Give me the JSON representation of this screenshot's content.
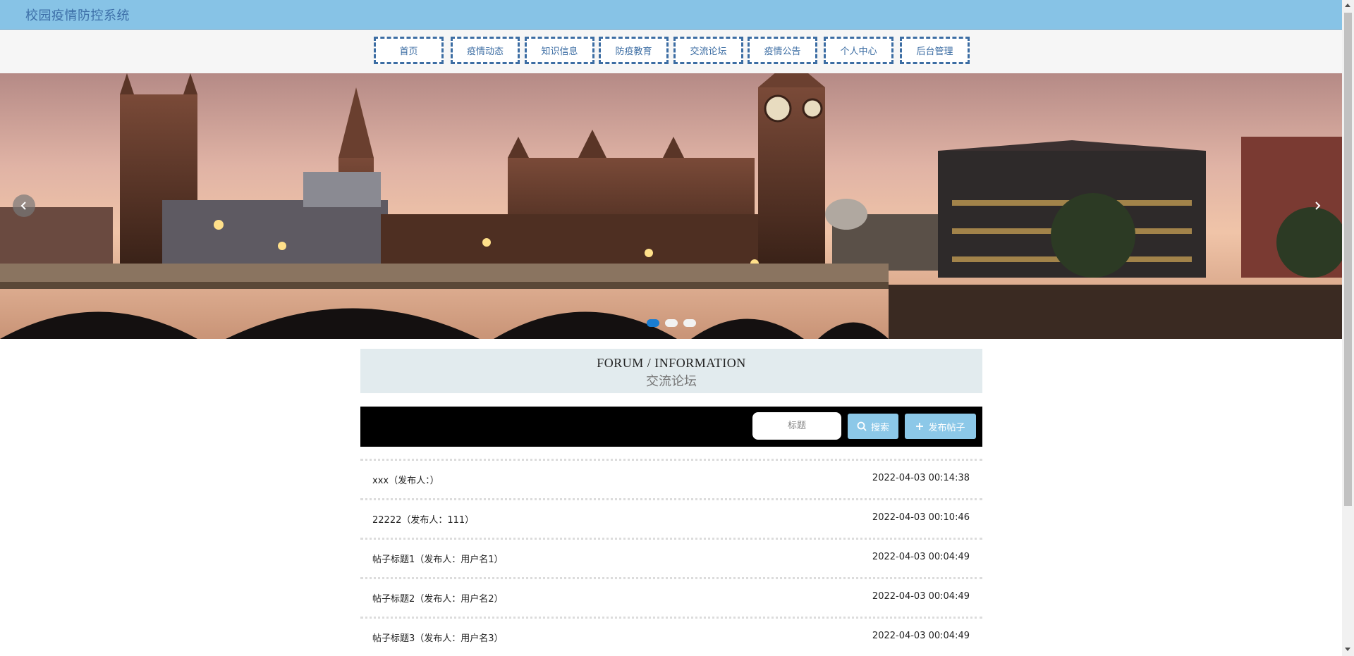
{
  "app": {
    "title": "校园疫情防控系统"
  },
  "nav": [
    {
      "label": "首页"
    },
    {
      "label": "疫情动态"
    },
    {
      "label": "知识信息"
    },
    {
      "label": "防疫教育"
    },
    {
      "label": "交流论坛"
    },
    {
      "label": "疫情公告"
    },
    {
      "label": "个人中心"
    },
    {
      "label": "后台管理"
    }
  ],
  "banner": {
    "slide_count": 3,
    "active_slide": 1,
    "prev_icon": "chevron-left-icon",
    "next_icon": "chevron-right-icon"
  },
  "section": {
    "title_en": "FORUM / INFORMATION",
    "title_cn": "交流论坛"
  },
  "search": {
    "placeholder": "标题",
    "search_label": "搜索",
    "post_label": "发布帖子",
    "search_icon": "search-icon",
    "post_icon": "plus-icon"
  },
  "posts": [
    {
      "title": "xxx（发布人：）",
      "date": "2022-04-03 00:14:38"
    },
    {
      "title": "22222（发布人：111）",
      "date": "2022-04-03 00:10:46"
    },
    {
      "title": "帖子标题1（发布人：用户名1）",
      "date": "2022-04-03 00:04:49"
    },
    {
      "title": "帖子标题2（发布人：用户名2）",
      "date": "2022-04-03 00:04:49"
    },
    {
      "title": "帖子标题3（发布人：用户名3）",
      "date": "2022-04-03 00:04:49"
    }
  ],
  "colors": {
    "header": "#87c3e6",
    "nav_border": "#3c6da3",
    "button": "#8cc8e8",
    "dot_active": "#1a7dd1",
    "section_bg": "#e2ebee"
  }
}
